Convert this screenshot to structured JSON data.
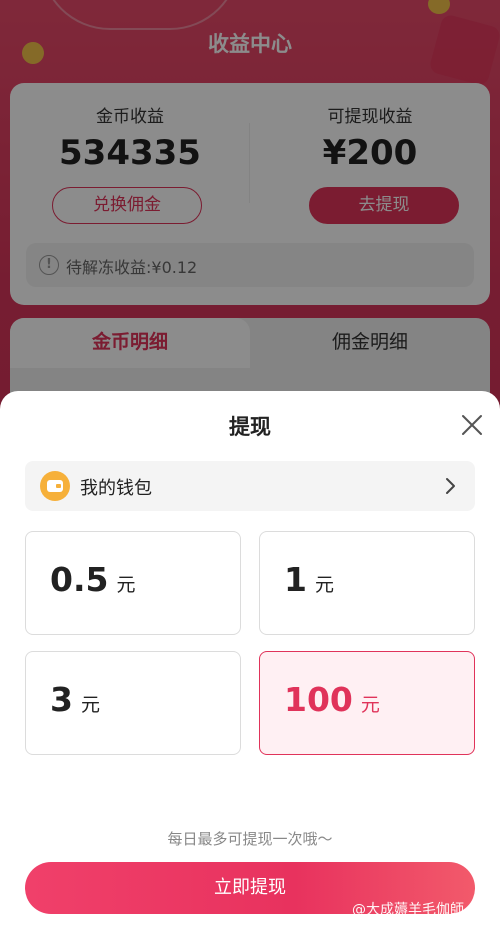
{
  "background_page": {
    "title": "收益中心",
    "coin_earnings": {
      "label": "金币收益",
      "value": "534335",
      "button": "兑换佣金"
    },
    "withdrawable": {
      "label": "可提现收益",
      "value": "¥200",
      "button": "去提现"
    },
    "pending_text": "待解冻收益:¥0.12",
    "tabs": [
      {
        "label": "金币明细"
      },
      {
        "label": "佣金明细"
      }
    ]
  },
  "sheet": {
    "title": "提现",
    "wallet_label": "我的钱包",
    "amount_options": [
      {
        "value": "0.5",
        "unit": "元",
        "selected": false
      },
      {
        "value": "1",
        "unit": "元",
        "selected": false
      },
      {
        "value": "3",
        "unit": "元",
        "selected": false
      },
      {
        "value": "100",
        "unit": "元",
        "selected": true
      }
    ],
    "limit_note": "每日最多可提现一次哦～",
    "submit_label": "立即提现"
  },
  "watermark": "@大成薅羊毛伽師",
  "colors": {
    "accent": "#e0335a",
    "selected_bg": "#fff0f3",
    "wallet_icon": "#f6b03a"
  },
  "icons": {
    "close": "close-icon",
    "chevron": "chevron-right-icon",
    "wallet": "wallet-icon",
    "info": "info-icon"
  }
}
